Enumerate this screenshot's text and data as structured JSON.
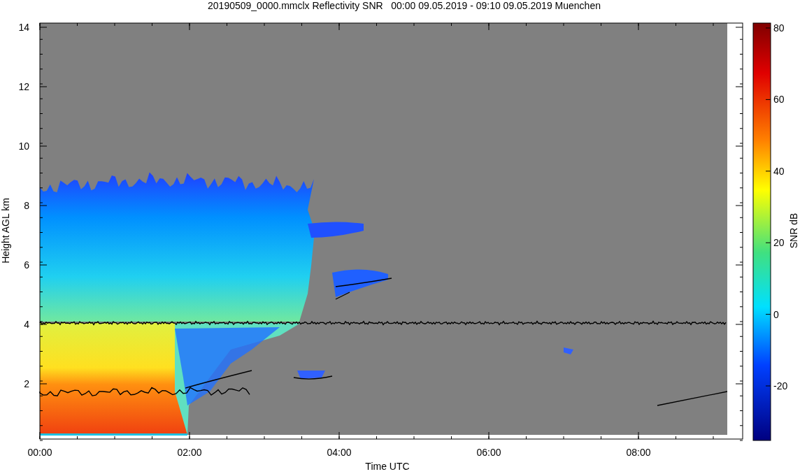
{
  "title": "20190509_0000.mmclx Reflectivity SNR   00:00 09.05.2019 - 09:10 09.05.2019 Muenchen",
  "y_axis": {
    "label": "Height AGL km",
    "ticks": [
      "14",
      "12",
      "10",
      "8",
      "6",
      "4",
      "2"
    ]
  },
  "x_axis": {
    "label": "Time UTC",
    "ticks": [
      "00:00",
      "02:00",
      "04:00",
      "06:00",
      "08:00"
    ]
  },
  "colorbar": {
    "label": "SNR dB",
    "ticks": [
      "80",
      "60",
      "40",
      "20",
      "0",
      "-20"
    ]
  }
}
